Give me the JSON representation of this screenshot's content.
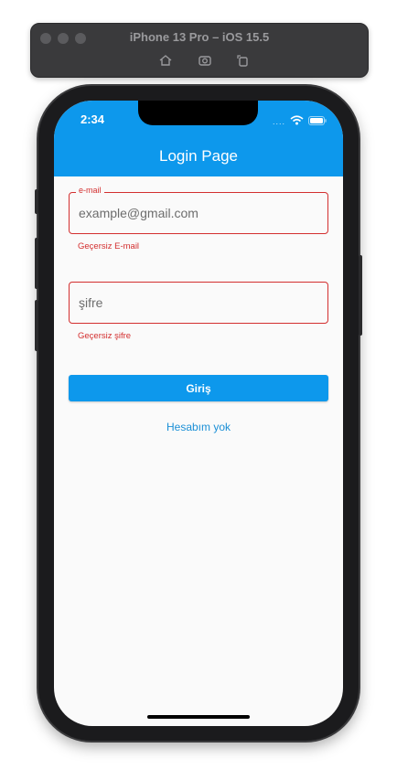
{
  "simulator": {
    "title": "iPhone 13 Pro – iOS 15.5",
    "toolbar_icons": [
      "home-icon",
      "screenshot-icon",
      "rotate-icon"
    ]
  },
  "status_bar": {
    "time": "2:34",
    "signal": "....",
    "icons": [
      "wifi-icon",
      "battery-icon"
    ]
  },
  "app_bar": {
    "title": "Login Page",
    "color": "#0d98ec"
  },
  "form": {
    "email": {
      "label": "e-mail",
      "placeholder": "example@gmail.com",
      "error": "Geçersiz E-mail"
    },
    "password": {
      "placeholder": "şifre",
      "error": "Geçersiz şifre"
    },
    "submit_label": "Giriş",
    "register_link": "Hesabım yok",
    "error_color": "#d32f2f"
  }
}
